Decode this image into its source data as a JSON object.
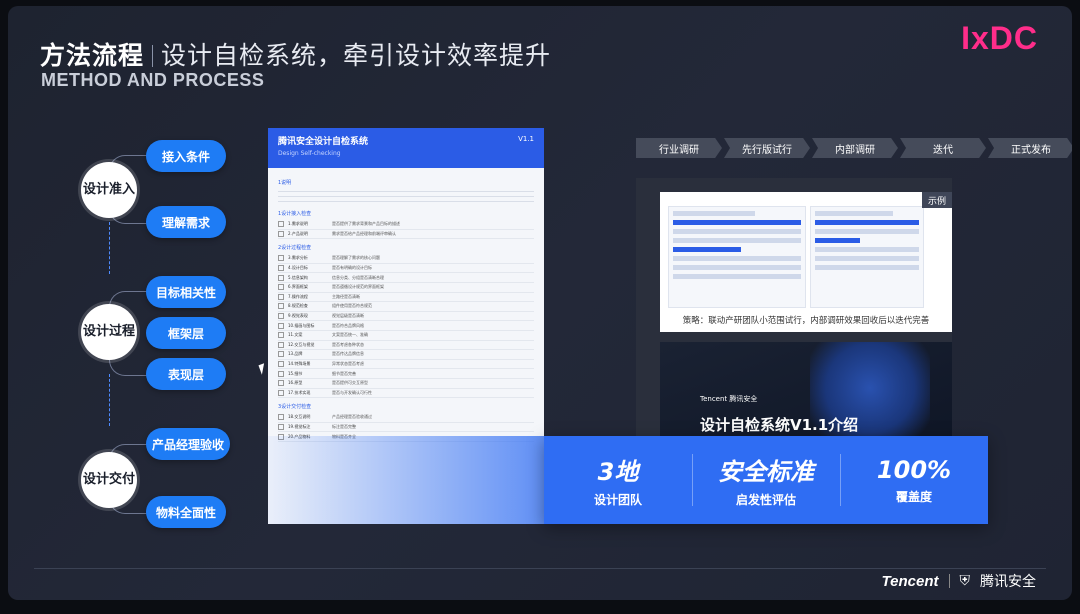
{
  "header": {
    "title_main": "方法流程",
    "title_sub": "设计自检系统，牵引设计效率提升",
    "subtitle": "METHOD AND PROCESS",
    "logo": "IxDC"
  },
  "flow": {
    "stages": [
      {
        "label": "设计准入",
        "items": [
          "接入条件",
          "理解需求"
        ]
      },
      {
        "label": "设计过程",
        "items": [
          "目标相关性",
          "框架层",
          "表现层"
        ]
      },
      {
        "label": "设计交付",
        "items": [
          "产品经理验收",
          "物料全面性"
        ]
      }
    ]
  },
  "doc": {
    "title": "腾讯安全设计自检系统",
    "subtitle": "Design Self-checking",
    "version": "V1.1",
    "intro_heading": "1说明",
    "sections": [
      {
        "heading": "1设计接入检查",
        "rows": [
          {
            "n": "1.需求说明",
            "d": "是否提供了需求背景和产品目标的描述"
          },
          {
            "n": "2.产品说明",
            "d": "需求是否给产品经理和前端评审确认"
          }
        ]
      },
      {
        "heading": "2设计过程检查",
        "rows": [
          {
            "n": "3.需求分析",
            "d": "是否理解了需求的核心问题"
          },
          {
            "n": "4.设计目标",
            "d": "是否有明确的设计目标"
          },
          {
            "n": "5.信息架构",
            "d": "信息分类、分组是否清晰合理"
          },
          {
            "n": "6.界面框架",
            "d": "是否遵循设计规范的界面框架"
          },
          {
            "n": "7.操作流程",
            "d": "主路径是否清晰"
          },
          {
            "n": "8.规范检查",
            "d": "组件使用是否符合规范"
          },
          {
            "n": "9.视觉表现",
            "d": "视觉层级是否清晰"
          },
          {
            "n": "10.插画与图标",
            "d": "是否符合品牌风格"
          },
          {
            "n": "11.文案",
            "d": "文案是否统一、准确"
          },
          {
            "n": "12.交互与视觉",
            "d": "是否考虑各种状态"
          },
          {
            "n": "13.品牌",
            "d": "是否传达品牌信息"
          },
          {
            "n": "14.特殊场景",
            "d": "异常状态是否考虑"
          },
          {
            "n": "15.细节",
            "d": "细节是否完善"
          },
          {
            "n": "16.原型",
            "d": "是否提供可交互原型"
          },
          {
            "n": "17.技术实现",
            "d": "是否与开发确认可行性"
          }
        ]
      },
      {
        "heading": "3设计交付检查",
        "rows": [
          {
            "n": "18.交互说明",
            "d": "产品经理是否验收通过"
          },
          {
            "n": "19.视觉标注",
            "d": "标注是否完整"
          },
          {
            "n": "20.产品物料",
            "d": "物料是否齐全"
          }
        ]
      }
    ]
  },
  "process_steps": [
    "行业调研",
    "先行版试行",
    "内部调研",
    "迭代",
    "正式发布"
  ],
  "example": {
    "tag": "示例",
    "caption": "策略：联动产研团队小范围试行，内部调研效果回收后以迭代完善"
  },
  "intro_card": {
    "brand": "Tencent 腾讯安全",
    "title": "设计自检系统V1.1介绍"
  },
  "stats": [
    {
      "value": "3地",
      "label": "设计团队"
    },
    {
      "value": "安全标准",
      "label": "启发性评估"
    },
    {
      "value": "100%",
      "label": "覆盖度"
    }
  ],
  "footer": {
    "brand": "Tencent",
    "product": "腾讯安全"
  },
  "colors": {
    "accent": "#1e7cf5",
    "logo": "#ff2d8a",
    "stat_bg": "#2f6df3"
  }
}
